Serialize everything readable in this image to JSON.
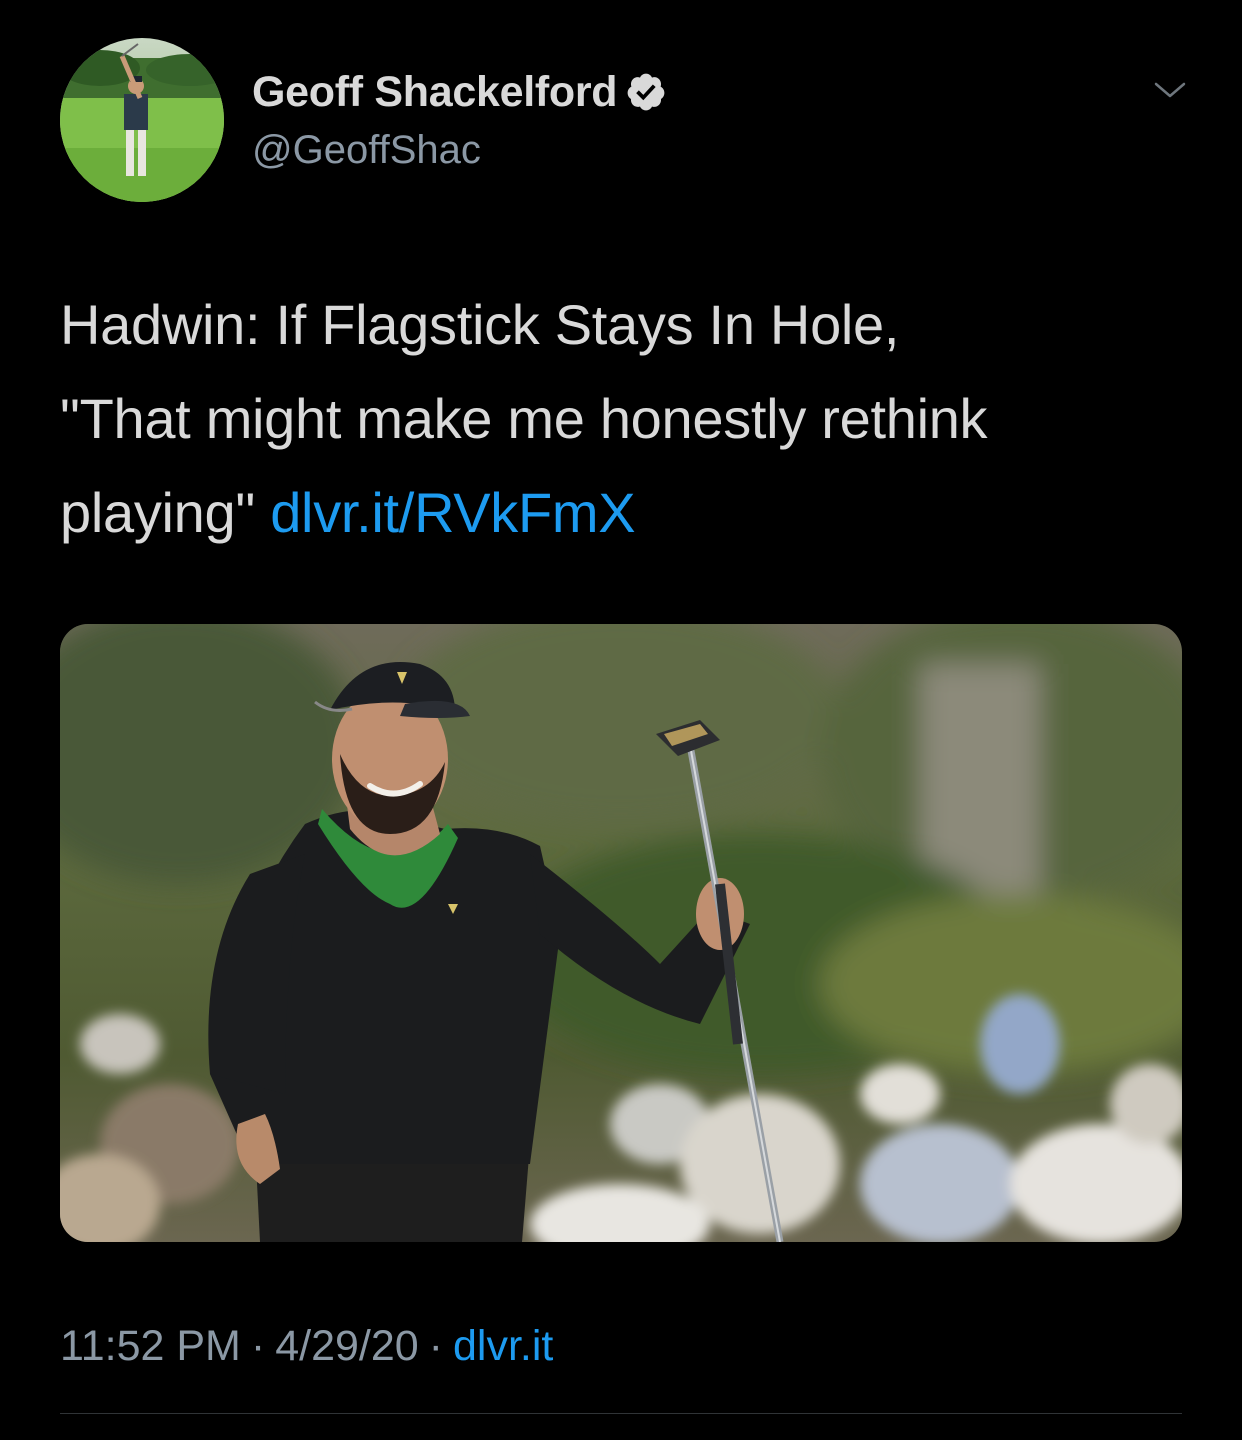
{
  "author": {
    "display_name": "Geoff Shackelford",
    "handle": "@GeoffShac",
    "verified_icon": "verified-badge-icon",
    "avatar_icon": "avatar"
  },
  "menu": {
    "icon": "chevron-down-icon"
  },
  "tweet": {
    "text_line_1": "Hadwin: If Flagstick Stays In Hole,",
    "text_line_2": "\"That might make me honestly rethink",
    "text_line_3_prefix": "playing\" ",
    "link": "dlvr.it/RVkFmX"
  },
  "media": {
    "type": "photo"
  },
  "meta": {
    "time": "11:52 PM",
    "separator": "·",
    "date": "4/29/20",
    "source": "dlvr.it"
  },
  "colors": {
    "background": "#000000",
    "text": "#d9d9d9",
    "secondary": "#8b98a5",
    "accent": "#1d9bf0"
  }
}
